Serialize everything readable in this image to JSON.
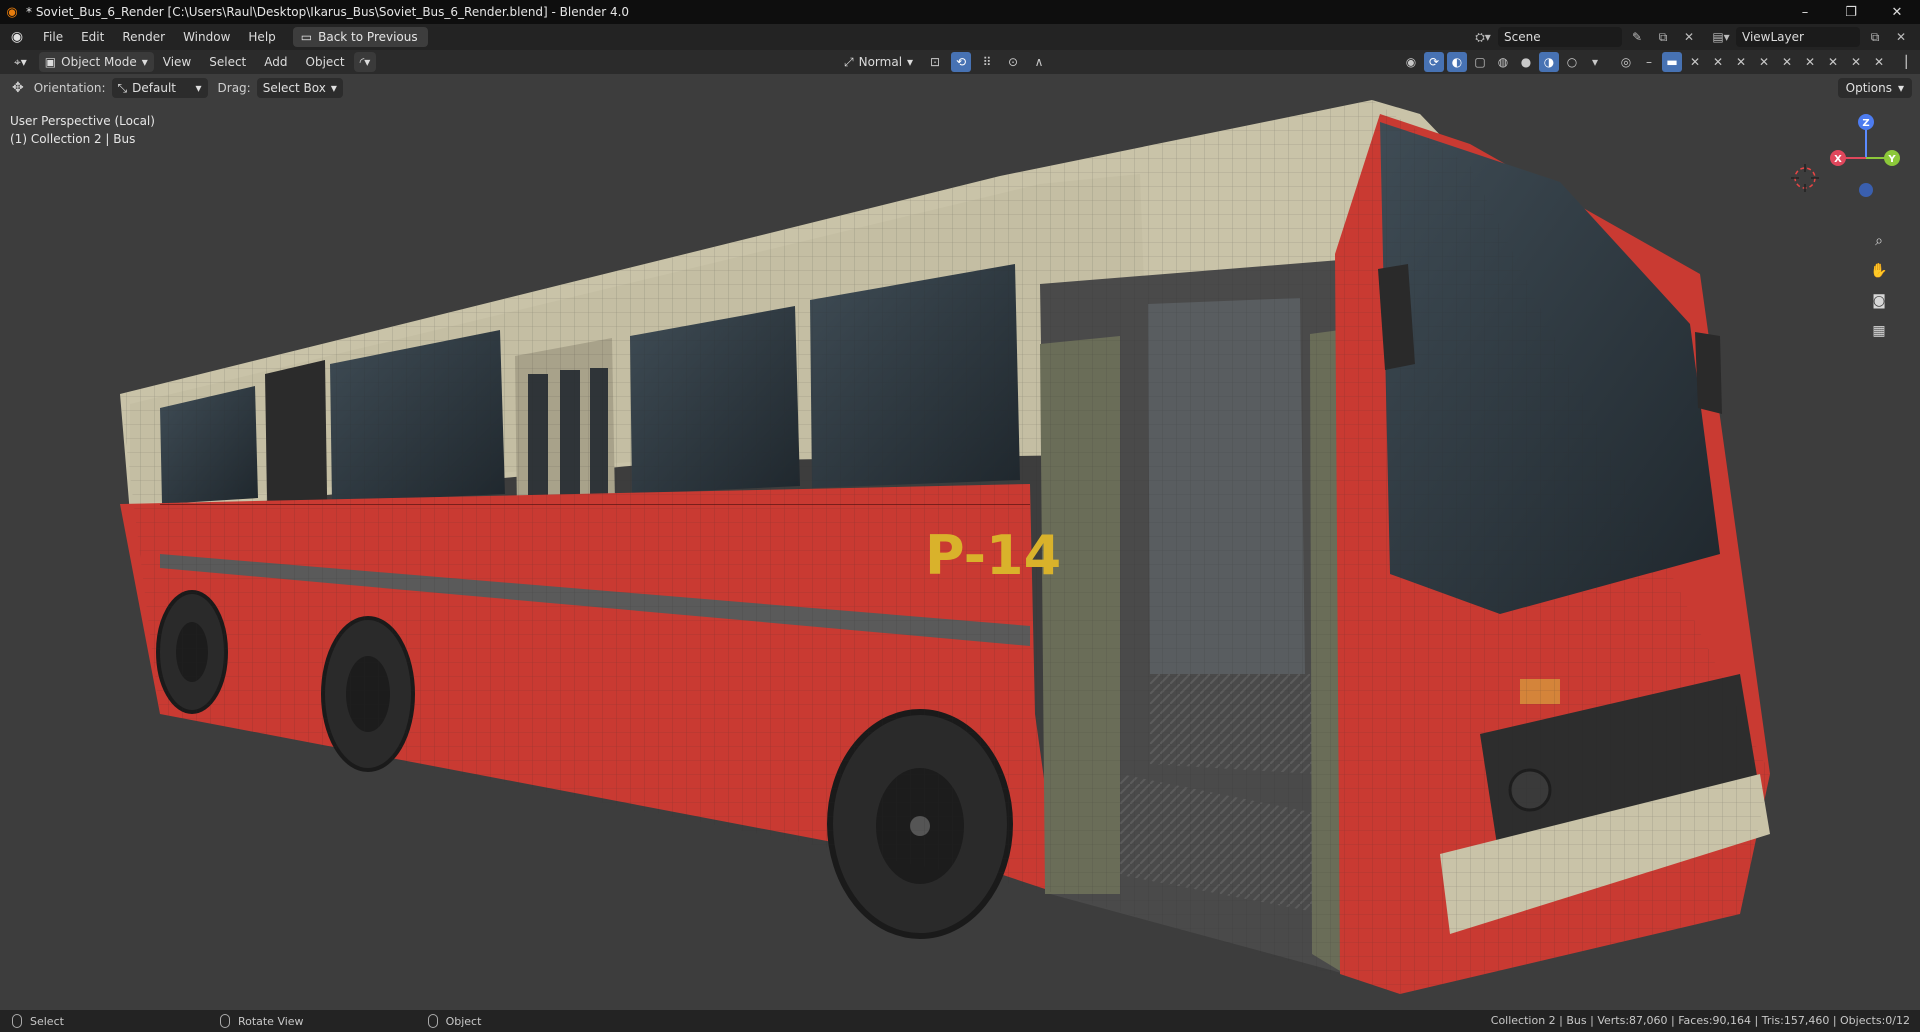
{
  "window": {
    "title": "* Soviet_Bus_6_Render [C:\\Users\\Raul\\Desktop\\Ikarus_Bus\\Soviet_Bus_6_Render.blend] - Blender 4.0",
    "controls": [
      "–",
      "❐",
      "✕"
    ]
  },
  "menu": {
    "items": [
      "File",
      "Edit",
      "Render",
      "Window",
      "Help"
    ],
    "back_button": "Back to Previous"
  },
  "scene": {
    "scene_name": "Scene",
    "view_layer": "ViewLayer"
  },
  "viewport_header": {
    "mode": "Object Mode",
    "menus": [
      "View",
      "Select",
      "Add",
      "Object"
    ],
    "transform_orientation": "Normal"
  },
  "tool_header": {
    "orientation_label": "Orientation:",
    "orientation_value": "Default",
    "drag_label": "Drag:",
    "drag_value": "Select Box",
    "options_label": "Options"
  },
  "viewport": {
    "perspective": "User Perspective (Local)",
    "collection_info": "(1) Collection 2 | Bus",
    "bus_label": "P-14",
    "gizmo": {
      "x": "X",
      "y": "Y",
      "z": "Z"
    }
  },
  "statusbar": {
    "select": "Select",
    "rotate": "Rotate View",
    "object": "Object",
    "stats": "Collection 2 | Bus | Verts:87,060 | Faces:90,164 | Tris:157,460 | Objects:0/12"
  },
  "colors": {
    "viewport_bg": "#3d3d3d",
    "bus_red": "#c93a32",
    "bus_cream": "#c9c3a8",
    "label_yellow": "#d9b22b",
    "accent_blue": "#4772b3"
  }
}
